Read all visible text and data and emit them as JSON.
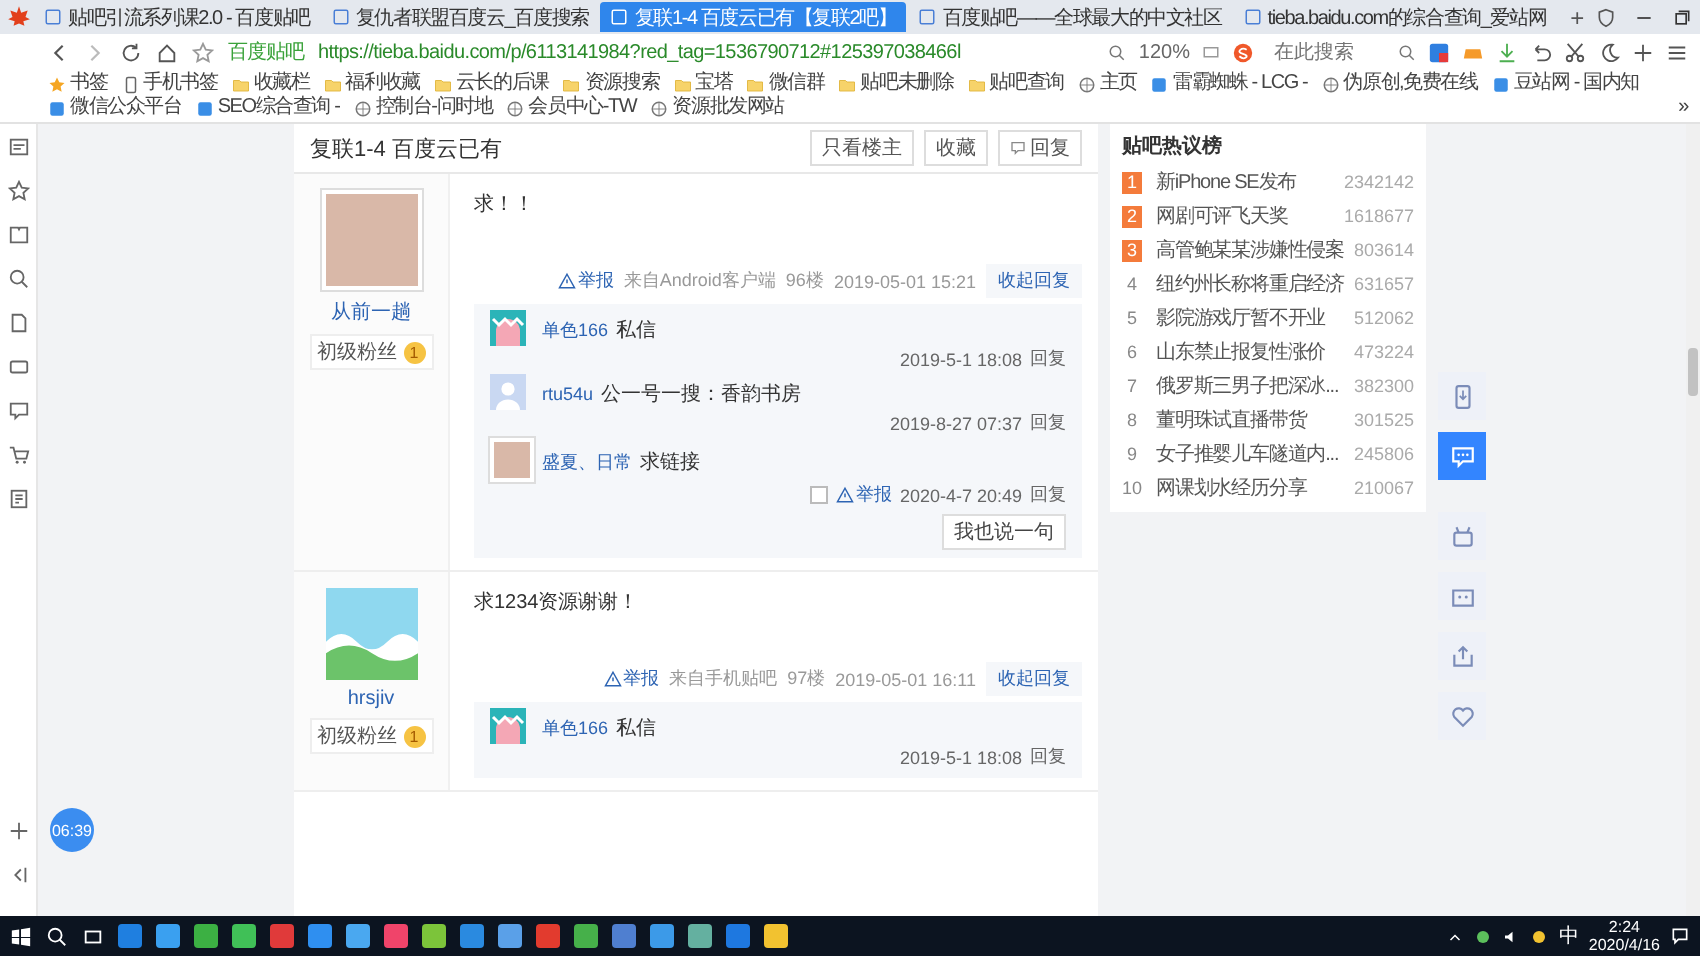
{
  "browser": {
    "tabs": [
      {
        "title": "贴吧引流系列课2.0 - 百度贴吧",
        "selected": false
      },
      {
        "title": "复仇者联盟百度云_百度搜索",
        "selected": false
      },
      {
        "title": "复联1-4 百度云已有【复联2吧】",
        "selected": true
      },
      {
        "title": "百度贴吧——全球最大的中文社区",
        "selected": false
      },
      {
        "title": "tieba.baidu.com的综合查询_爱站网",
        "selected": false
      }
    ],
    "new_tab": "+",
    "site_label": "百度贴吧",
    "url": "https://tieba.baidu.com/p/6113141984?red_tag=1536790712#125397038466l",
    "zoom": "120%",
    "search_placeholder": "在此搜索",
    "bookmarks": [
      {
        "label": "书签",
        "kind": "star"
      },
      {
        "label": "手机书签",
        "kind": "phone"
      },
      {
        "label": "收藏栏",
        "kind": "folder"
      },
      {
        "label": "福利收藏",
        "kind": "folder"
      },
      {
        "label": "云长的后课",
        "kind": "folder"
      },
      {
        "label": "资源搜索",
        "kind": "folder"
      },
      {
        "label": "宝塔",
        "kind": "folder"
      },
      {
        "label": "微信群",
        "kind": "folder"
      },
      {
        "label": "贴吧未删除",
        "kind": "folder"
      },
      {
        "label": "贴吧查询",
        "kind": "folder"
      },
      {
        "label": "主页",
        "kind": "globe"
      },
      {
        "label": "雷霸蜘蛛 - LCG -",
        "kind": "site"
      },
      {
        "label": "伪原创,免费在线",
        "kind": "globe"
      },
      {
        "label": "豆站网 - 国内知",
        "kind": "site"
      },
      {
        "label": "微信公众平台",
        "kind": "site"
      },
      {
        "label": "SEO综合查询 -",
        "kind": "site"
      },
      {
        "label": "控制台-问时地",
        "kind": "globe"
      },
      {
        "label": "会员中心-TW",
        "kind": "globe"
      },
      {
        "label": "资源批发网站",
        "kind": "globe"
      }
    ],
    "bookmarks_more": "»"
  },
  "thread": {
    "title": "复联1-4 百度云已有",
    "actions": [
      "只看楼主",
      "收藏",
      "回复"
    ],
    "posts": [
      {
        "avatar": {
          "kind": "photo"
        },
        "author": "从前一趟",
        "badge": "初级粉丝",
        "level": "1",
        "content": "求！！",
        "report": "举报",
        "source": "来自Android客户端",
        "floor": "96楼",
        "time": "2019-05-01 15:21",
        "collapse": "收起回复",
        "replies": [
          {
            "avatar": {
              "kind": "cartoon"
            },
            "author": "单色166",
            "text": "私信",
            "time": "2019-5-1 18:08",
            "reply": "回复"
          },
          {
            "avatar": {
              "kind": "default"
            },
            "author": "rtu54u",
            "text": "公一号一搜：香韵书房",
            "time": "2019-8-27 07:37",
            "reply": "回复"
          },
          {
            "avatar": {
              "kind": "photo"
            },
            "author": "盛夏、日常",
            "text": "求链接",
            "report": "举报",
            "time": "2020-4-7 20:49",
            "reply": "回复"
          }
        ],
        "reply_button": "我也说一句"
      },
      {
        "avatar": {
          "kind": "landscape"
        },
        "author": "hrsjiv",
        "badge": "初级粉丝",
        "level": "1",
        "content": "求1234资源谢谢！",
        "report": "举报",
        "source": "来自手机贴吧",
        "floor": "97楼",
        "time": "2019-05-01 16:11",
        "collapse": "收起回复",
        "replies": [
          {
            "avatar": {
              "kind": "cartoon"
            },
            "author": "单色166",
            "text": "私信",
            "time": "2019-5-1 18:08",
            "reply": "回复"
          }
        ]
      }
    ]
  },
  "hot_list": {
    "title": "贴吧热议榜",
    "items": [
      {
        "rank": "1",
        "title": "新iPhone SE发布",
        "count": "2342142",
        "hot": true
      },
      {
        "rank": "2",
        "title": "网剧可评飞天奖",
        "count": "1618677",
        "hot": true
      },
      {
        "rank": "3",
        "title": "高管鲍某某涉嫌性侵案",
        "count": "803614",
        "hot": true
      },
      {
        "rank": "4",
        "title": "纽约州长称将重启经济",
        "count": "631657",
        "hot": false
      },
      {
        "rank": "5",
        "title": "影院游戏厅暂不开业",
        "count": "512062",
        "hot": false
      },
      {
        "rank": "6",
        "title": "山东禁止报复性涨价",
        "count": "473224",
        "hot": false
      },
      {
        "rank": "7",
        "title": "俄罗斯三男子把深冰...",
        "count": "382300",
        "hot": false
      },
      {
        "rank": "8",
        "title": "董明珠试直播带货",
        "count": "301525",
        "hot": false
      },
      {
        "rank": "9",
        "title": "女子推婴儿车隧道内...",
        "count": "245806",
        "hot": false
      },
      {
        "rank": "10",
        "title": "网课划水经历分享",
        "count": "210067",
        "hot": false
      }
    ]
  },
  "tools": [
    {
      "kind": "phone",
      "selected": false
    },
    {
      "kind": "chat",
      "selected": true
    },
    {
      "kind": "robot",
      "selected": false
    },
    {
      "kind": "face",
      "selected": false
    },
    {
      "kind": "share",
      "selected": false
    },
    {
      "kind": "heart",
      "selected": false
    }
  ],
  "timer": "06:39",
  "taskbar": {
    "ime": "中",
    "time": "2:24",
    "date": "2020/4/16"
  }
}
